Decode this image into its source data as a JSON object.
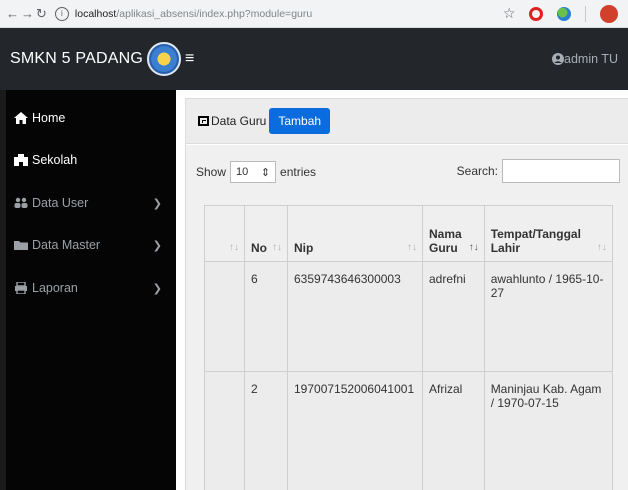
{
  "browser": {
    "host": "localhost",
    "path": "/aplikasi_absensi/index.php?module=guru"
  },
  "navbar": {
    "brand": "SMKN 5 PADANG",
    "user": "admin TU"
  },
  "sidebar": {
    "items": [
      {
        "label": "Home",
        "icon": "home-icon"
      },
      {
        "label": "Sekolah",
        "icon": "building-icon"
      },
      {
        "label": "Data User",
        "icon": "users-icon"
      },
      {
        "label": "Data Master",
        "icon": "folder-icon"
      },
      {
        "label": "Laporan",
        "icon": "print-icon"
      }
    ]
  },
  "card": {
    "title": "Data Guru",
    "add_label": "Tambah"
  },
  "table_controls": {
    "show_label": "Show",
    "entries_value": "10",
    "entries_label": "entries",
    "search_label": "Search:"
  },
  "table": {
    "headers": {
      "no": "No",
      "nip": "Nip",
      "nama": "Nama Guru",
      "tempat": "Tempat/Tanggal Lahir"
    },
    "rows": [
      {
        "no": "6",
        "nip": "6359743646300003",
        "nama": "adrefni",
        "tempat": "awahlunto / 1965-10-27"
      },
      {
        "no": "2",
        "nip": "197007152006041001",
        "nama": "Afrizal",
        "tempat": "Maninjau Kab. Agam / 1970-07-15"
      }
    ]
  },
  "colors": {
    "navbar": "#23272b",
    "sidebar": "#050505",
    "primary_button": "#0a6cdf"
  }
}
